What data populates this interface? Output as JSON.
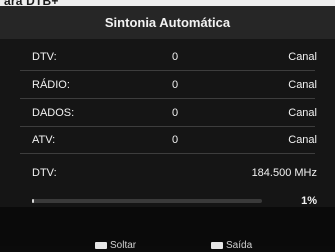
{
  "header_strip": {
    "text": "ara DTB+"
  },
  "dialog": {
    "title": "Sintonia Automática",
    "rows": [
      {
        "label": "DTV:",
        "count": "0",
        "unit": "Canal"
      },
      {
        "label": "RÁDIO:",
        "count": "0",
        "unit": "Canal"
      },
      {
        "label": "DADOS:",
        "count": "0",
        "unit": "Canal"
      },
      {
        "label": "ATV:",
        "count": "0",
        "unit": "Canal"
      }
    ],
    "scan": {
      "label": "DTV:",
      "frequency": "184.500 MHz",
      "progress_percent": 1,
      "progress_text": "1%"
    }
  },
  "footer": {
    "hints": [
      {
        "icon": "key-icon",
        "label": "Soltar"
      },
      {
        "icon": "key-icon",
        "label": "Saída"
      }
    ]
  },
  "colors": {
    "background": "#0b0b0b",
    "title_bar": "#262626",
    "panel": "#151515",
    "progress_fill": "#d8d8d8"
  }
}
